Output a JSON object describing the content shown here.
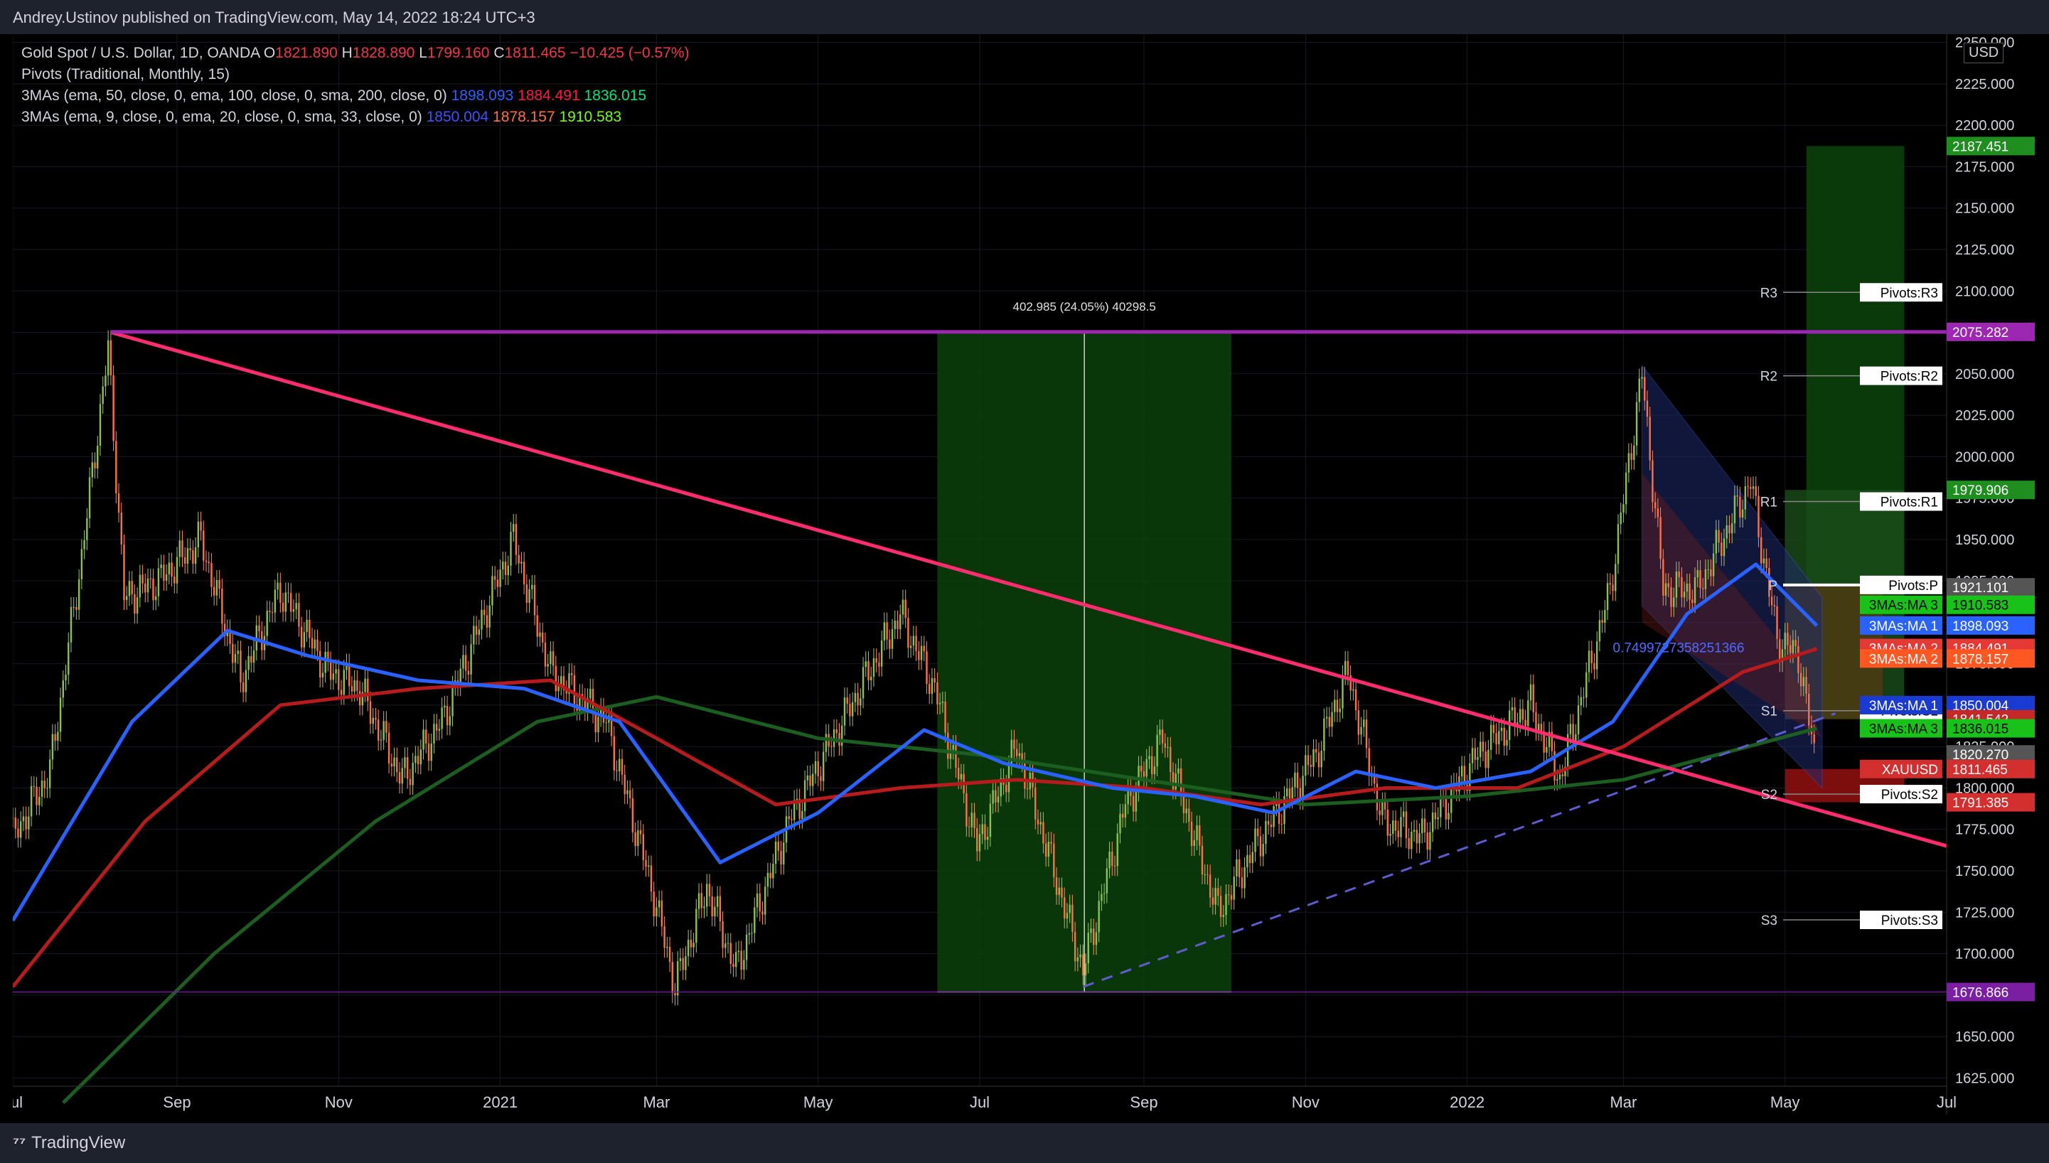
{
  "header": {
    "publisher": "Andrey.Ustinov published on TradingView.com, May 14, 2022 18:24 UTC+3"
  },
  "legend": {
    "symbol": "Gold Spot / U.S. Dollar, 1D, OANDA",
    "open_label": "O",
    "open": "1821.890",
    "high_label": "H",
    "high": "1828.890",
    "low_label": "L",
    "low": "1799.160",
    "close_label": "C",
    "close": "1811.465",
    "change": "−10.425 (−0.57%)",
    "pivots": "Pivots (Traditional, Monthly, 15)",
    "ma1_text": "3MAs (ema, 50, close, 0, ema, 100, close, 0, sma, 200, close, 0)",
    "ma1_v1": "1898.093",
    "ma1_v2": "1884.491",
    "ma1_v3": "1836.015",
    "ma2_text": "3MAs (ema, 9, close, 0, ema, 20, close, 0, sma, 33, close, 0)",
    "ma2_v1": "1850.004",
    "ma2_v2": "1878.157",
    "ma2_v3": "1910.583"
  },
  "currency": "USD",
  "footer": {
    "brand": "TradingView"
  },
  "colors": {
    "up": "#26a69a",
    "down": "#ef5350",
    "ema50": "#2962ff",
    "ema100": "#b71c1c",
    "sma200": "#1b5e20",
    "trendline": "#ff2d6f",
    "resistance": "#9c27b0",
    "zone_green": "#0b3d0b"
  },
  "chart_data": {
    "type": "candlestick",
    "title": "Gold Spot / U.S. Dollar, 1D, OANDA",
    "ylim": [
      1620,
      2255
    ],
    "y_ticks": [
      "1625.000",
      "1650.000",
      "1675.000",
      "1700.000",
      "1725.000",
      "1750.000",
      "1775.000",
      "1800.000",
      "1825.000",
      "1850.000",
      "1875.000",
      "1900.000",
      "1925.000",
      "1950.000",
      "1975.000",
      "2000.000",
      "2025.000",
      "2050.000",
      "2075.000",
      "2100.000",
      "2125.000",
      "2150.000",
      "2175.000",
      "2200.000",
      "2225.000",
      "2250.000"
    ],
    "x_ticks": [
      "Jul",
      "Sep",
      "Nov",
      "2021",
      "Mar",
      "May",
      "Jul",
      "Sep",
      "Nov",
      "2022",
      "Mar",
      "May",
      "Jul"
    ],
    "x_range": [
      "2020-07-01",
      "2022-07-01"
    ],
    "close_series": [
      {
        "date": "2020-07-01",
        "v": 1770
      },
      {
        "date": "2020-07-15",
        "v": 1810
      },
      {
        "date": "2020-07-27",
        "v": 1940
      },
      {
        "date": "2020-08-06",
        "v": 2065
      },
      {
        "date": "2020-08-12",
        "v": 1915
      },
      {
        "date": "2020-08-25",
        "v": 1925
      },
      {
        "date": "2020-09-10",
        "v": 1950
      },
      {
        "date": "2020-09-25",
        "v": 1865
      },
      {
        "date": "2020-10-10",
        "v": 1920
      },
      {
        "date": "2020-10-28",
        "v": 1870
      },
      {
        "date": "2020-11-09",
        "v": 1860
      },
      {
        "date": "2020-11-25",
        "v": 1805
      },
      {
        "date": "2020-12-10",
        "v": 1840
      },
      {
        "date": "2021-01-06",
        "v": 1950
      },
      {
        "date": "2021-01-20",
        "v": 1870
      },
      {
        "date": "2021-02-10",
        "v": 1840
      },
      {
        "date": "2021-02-28",
        "v": 1735
      },
      {
        "date": "2021-03-08",
        "v": 1680
      },
      {
        "date": "2021-03-20",
        "v": 1740
      },
      {
        "date": "2021-03-31",
        "v": 1690
      },
      {
        "date": "2021-04-20",
        "v": 1780
      },
      {
        "date": "2021-05-10",
        "v": 1840
      },
      {
        "date": "2021-06-01",
        "v": 1905
      },
      {
        "date": "2021-06-14",
        "v": 1860
      },
      {
        "date": "2021-06-30",
        "v": 1765
      },
      {
        "date": "2021-07-15",
        "v": 1825
      },
      {
        "date": "2021-08-09",
        "v": 1690
      },
      {
        "date": "2021-08-25",
        "v": 1790
      },
      {
        "date": "2021-09-08",
        "v": 1830
      },
      {
        "date": "2021-09-29",
        "v": 1725
      },
      {
        "date": "2021-10-15",
        "v": 1770
      },
      {
        "date": "2021-11-05",
        "v": 1820
      },
      {
        "date": "2021-11-17",
        "v": 1870
      },
      {
        "date": "2021-11-30",
        "v": 1780
      },
      {
        "date": "2021-12-15",
        "v": 1770
      },
      {
        "date": "2022-01-05",
        "v": 1820
      },
      {
        "date": "2022-01-25",
        "v": 1850
      },
      {
        "date": "2022-02-05",
        "v": 1805
      },
      {
        "date": "2022-02-24",
        "v": 1920
      },
      {
        "date": "2022-03-08",
        "v": 2050
      },
      {
        "date": "2022-03-16",
        "v": 1920
      },
      {
        "date": "2022-03-29",
        "v": 1920
      },
      {
        "date": "2022-04-18",
        "v": 1985
      },
      {
        "date": "2022-04-28",
        "v": 1890
      },
      {
        "date": "2022-05-06",
        "v": 1880
      },
      {
        "date": "2022-05-13",
        "v": 1811
      }
    ],
    "ema50_series": [
      {
        "date": "2020-07-01",
        "v": 1720
      },
      {
        "date": "2020-08-15",
        "v": 1840
      },
      {
        "date": "2020-09-20",
        "v": 1895
      },
      {
        "date": "2020-10-20",
        "v": 1880
      },
      {
        "date": "2020-12-01",
        "v": 1865
      },
      {
        "date": "2021-01-10",
        "v": 1860
      },
      {
        "date": "2021-02-15",
        "v": 1840
      },
      {
        "date": "2021-03-25",
        "v": 1755
      },
      {
        "date": "2021-05-01",
        "v": 1785
      },
      {
        "date": "2021-06-10",
        "v": 1835
      },
      {
        "date": "2021-07-10",
        "v": 1815
      },
      {
        "date": "2021-08-20",
        "v": 1800
      },
      {
        "date": "2021-09-20",
        "v": 1795
      },
      {
        "date": "2021-10-20",
        "v": 1785
      },
      {
        "date": "2021-11-20",
        "v": 1810
      },
      {
        "date": "2021-12-20",
        "v": 1800
      },
      {
        "date": "2022-01-25",
        "v": 1810
      },
      {
        "date": "2022-02-25",
        "v": 1840
      },
      {
        "date": "2022-03-25",
        "v": 1905
      },
      {
        "date": "2022-04-20",
        "v": 1935
      },
      {
        "date": "2022-05-13",
        "v": 1898
      }
    ],
    "ema100_series": [
      {
        "date": "2020-07-01",
        "v": 1680
      },
      {
        "date": "2020-08-20",
        "v": 1780
      },
      {
        "date": "2020-10-10",
        "v": 1850
      },
      {
        "date": "2020-12-01",
        "v": 1860
      },
      {
        "date": "2021-01-20",
        "v": 1865
      },
      {
        "date": "2021-03-01",
        "v": 1830
      },
      {
        "date": "2021-04-15",
        "v": 1790
      },
      {
        "date": "2021-06-01",
        "v": 1800
      },
      {
        "date": "2021-07-15",
        "v": 1805
      },
      {
        "date": "2021-09-01",
        "v": 1800
      },
      {
        "date": "2021-10-15",
        "v": 1790
      },
      {
        "date": "2021-12-01",
        "v": 1800
      },
      {
        "date": "2022-01-20",
        "v": 1800
      },
      {
        "date": "2022-03-01",
        "v": 1825
      },
      {
        "date": "2022-04-15",
        "v": 1870
      },
      {
        "date": "2022-05-13",
        "v": 1884
      }
    ],
    "sma200_series": [
      {
        "date": "2020-07-20",
        "v": 1610
      },
      {
        "date": "2020-09-15",
        "v": 1700
      },
      {
        "date": "2020-11-15",
        "v": 1780
      },
      {
        "date": "2021-01-15",
        "v": 1840
      },
      {
        "date": "2021-03-01",
        "v": 1855
      },
      {
        "date": "2021-05-01",
        "v": 1830
      },
      {
        "date": "2021-07-01",
        "v": 1820
      },
      {
        "date": "2021-09-01",
        "v": 1805
      },
      {
        "date": "2021-11-01",
        "v": 1790
      },
      {
        "date": "2022-01-01",
        "v": 1795
      },
      {
        "date": "2022-03-01",
        "v": 1805
      },
      {
        "date": "2022-05-13",
        "v": 1836
      }
    ],
    "trendlines": [
      {
        "name": "descending-trendline",
        "from": {
          "date": "2020-08-07",
          "v": 2075
        },
        "to": {
          "date": "2022-07-01",
          "v": 1765
        }
      },
      {
        "name": "horizontal-resistance",
        "from": {
          "date": "2020-08-07",
          "v": 2075.282
        },
        "to": {
          "date": "2022-07-01",
          "v": 2075.282
        }
      },
      {
        "name": "dashed-support",
        "from": {
          "date": "2021-08-09",
          "v": 1680
        },
        "to": {
          "date": "2022-05-20",
          "v": 1845
        },
        "dashed": true
      },
      {
        "name": "bottom-level",
        "from": {
          "date": "2020-07-01",
          "v": 1676.866
        },
        "to": {
          "date": "2022-07-01",
          "v": 1676.866
        }
      }
    ],
    "measure": {
      "label": "402.985 (24.05%) 40298.5",
      "from_date": "2021-06-15",
      "to_date": "2021-10-04",
      "low": 1676.866,
      "high": 2075.282
    },
    "pivot_levels": [
      {
        "label": "R3",
        "name": "Pivots:R3",
        "value": "2099.140",
        "v": 2099.14
      },
      {
        "label": "R2",
        "name": "Pivots:R2",
        "value": "2048.800",
        "v": 2048.8
      },
      {
        "label": "R1",
        "name": "Pivots:R1",
        "value": "1972.895",
        "v": 1972.895
      },
      {
        "label": "P",
        "name": "Pivots:P",
        "value": "1922.555",
        "v": 1922.555
      },
      {
        "label": "S1",
        "name": "Pivots:S1",
        "value": "1846.650",
        "v": 1846.65
      },
      {
        "label": "S2",
        "name": "Pivots:S2",
        "value": "1796.310",
        "v": 1796.31
      },
      {
        "label": "S3",
        "name": "Pivots:S3",
        "value": "1720.405",
        "v": 1720.405
      }
    ],
    "price_tags": [
      {
        "value": "2187.451",
        "v": 2187.451,
        "bg": "#1e8f1e",
        "fg": "#ffffff"
      },
      {
        "value": "2075.282",
        "v": 2075.282,
        "bg": "#9c27b0",
        "fg": "#ffffff"
      },
      {
        "value": "1979.906",
        "v": 1979.906,
        "bg": "#1e8f1e",
        "fg": "#ffffff"
      },
      {
        "value": "1921.101",
        "v": 1921.101,
        "bg": "#555555",
        "fg": "#ffffff"
      },
      {
        "value": "1910.583",
        "v": 1910.583,
        "label": "3MAs:MA 3",
        "bg": "#19c219",
        "fg": "#000000"
      },
      {
        "value": "1898.093",
        "v": 1898.093,
        "label": "3MAs:MA 1",
        "bg": "#2962ff",
        "fg": "#ffffff"
      },
      {
        "value": "1884.491",
        "v": 1884.491,
        "label": "3MAs:MA 2",
        "bg": "#e53935",
        "fg": "#ffffff"
      },
      {
        "value": "1878.157",
        "v": 1878.157,
        "label": "3MAs:MA 2",
        "bg": "#ff5722",
        "fg": "#ffffff"
      },
      {
        "value": "1850.004",
        "v": 1850.004,
        "label": "3MAs:MA 1",
        "bg": "#1a3bd1",
        "fg": "#ffffff"
      },
      {
        "value": "1841.542",
        "v": 1841.542,
        "bg": "#c62828",
        "fg": "#ffffff"
      },
      {
        "value": "1836.015",
        "v": 1836.015,
        "label": "3MAs:MA 3",
        "bg": "#19c219",
        "fg": "#000000"
      },
      {
        "value": "1820.270",
        "v": 1820.27,
        "bg": "#555555",
        "fg": "#ffffff"
      },
      {
        "value": "1811.465",
        "v": 1811.465,
        "label": "XAUUSD",
        "bg": "#d32f2f",
        "fg": "#ffffff"
      },
      {
        "value": "1791.385",
        "v": 1791.385,
        "bg": "#d32f2f",
        "fg": "#ffffff"
      },
      {
        "value": "1676.866",
        "v": 1676.866,
        "bg": "#7b1fa2",
        "fg": "#ffffff"
      }
    ],
    "fib_label": "0.7499727358251366"
  }
}
